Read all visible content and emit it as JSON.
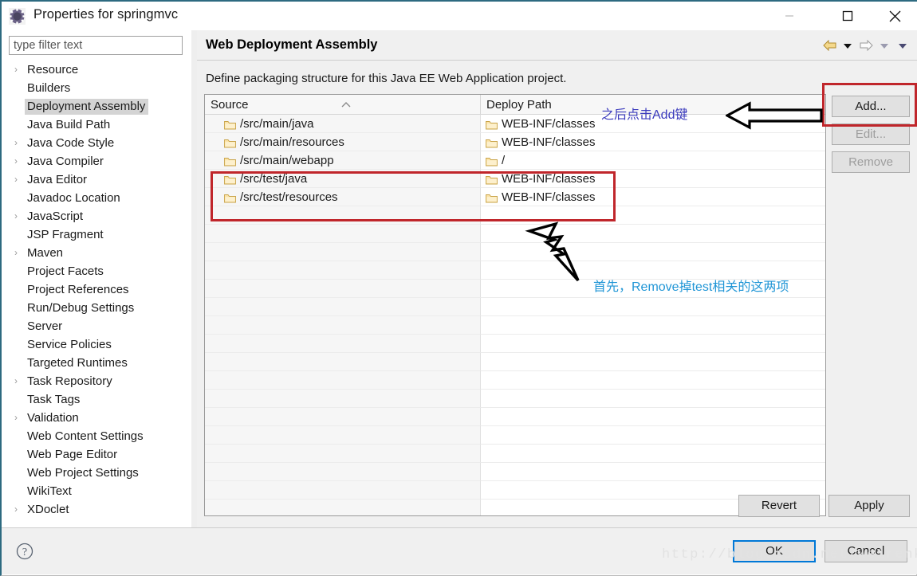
{
  "window": {
    "title": "Properties for springmvc",
    "app_icon": "gear-icon",
    "minimize_label": "Minimize",
    "maximize_label": "Maximize",
    "close_label": "Close"
  },
  "sidebar": {
    "filter": {
      "placeholder": "type filter text",
      "value": ""
    },
    "items": [
      {
        "label": "Resource",
        "expandable": true,
        "selected": false
      },
      {
        "label": "Builders",
        "expandable": false,
        "selected": false
      },
      {
        "label": "Deployment Assembly",
        "expandable": false,
        "selected": true
      },
      {
        "label": "Java Build Path",
        "expandable": false,
        "selected": false
      },
      {
        "label": "Java Code Style",
        "expandable": true,
        "selected": false
      },
      {
        "label": "Java Compiler",
        "expandable": true,
        "selected": false
      },
      {
        "label": "Java Editor",
        "expandable": true,
        "selected": false
      },
      {
        "label": "Javadoc Location",
        "expandable": false,
        "selected": false
      },
      {
        "label": "JavaScript",
        "expandable": true,
        "selected": false
      },
      {
        "label": "JSP Fragment",
        "expandable": false,
        "selected": false
      },
      {
        "label": "Maven",
        "expandable": true,
        "selected": false
      },
      {
        "label": "Project Facets",
        "expandable": false,
        "selected": false
      },
      {
        "label": "Project References",
        "expandable": false,
        "selected": false
      },
      {
        "label": "Run/Debug Settings",
        "expandable": false,
        "selected": false
      },
      {
        "label": "Server",
        "expandable": false,
        "selected": false
      },
      {
        "label": "Service Policies",
        "expandable": false,
        "selected": false
      },
      {
        "label": "Targeted Runtimes",
        "expandable": false,
        "selected": false
      },
      {
        "label": "Task Repository",
        "expandable": true,
        "selected": false
      },
      {
        "label": "Task Tags",
        "expandable": false,
        "selected": false
      },
      {
        "label": "Validation",
        "expandable": true,
        "selected": false
      },
      {
        "label": "Web Content Settings",
        "expandable": false,
        "selected": false
      },
      {
        "label": "Web Page Editor",
        "expandable": false,
        "selected": false
      },
      {
        "label": "Web Project Settings",
        "expandable": false,
        "selected": false
      },
      {
        "label": "WikiText",
        "expandable": false,
        "selected": false
      },
      {
        "label": "XDoclet",
        "expandable": true,
        "selected": false
      }
    ]
  },
  "page": {
    "title": "Web Deployment Assembly",
    "description": "Define packaging structure for this Java EE Web Application project.",
    "nav": {
      "back_icon": "back-arrow-icon",
      "back_menu_icon": "chevron-down-icon",
      "forward_icon": "forward-arrow-icon",
      "forward_menu_icon": "chevron-down-icon",
      "view_menu_icon": "chevron-down-icon"
    }
  },
  "table": {
    "columns": [
      {
        "key": "source",
        "label": "Source",
        "sort_indicator": "sort-asc-icon"
      },
      {
        "key": "deploy",
        "label": "Deploy Path",
        "sort_indicator": ""
      }
    ],
    "rows": [
      {
        "source": "/src/main/java",
        "deploy": "WEB-INF/classes",
        "highlighted": false
      },
      {
        "source": "/src/main/resources",
        "deploy": "WEB-INF/classes",
        "highlighted": false
      },
      {
        "source": "/src/main/webapp",
        "deploy": "/",
        "highlighted": false
      },
      {
        "source": "/src/test/java",
        "deploy": "WEB-INF/classes",
        "highlighted": true
      },
      {
        "source": "/src/test/resources",
        "deploy": "WEB-INF/classes",
        "highlighted": true
      }
    ],
    "empty_row_count": 17,
    "folder_icon": "folder-icon"
  },
  "buttons": {
    "add": {
      "label": "Add...",
      "enabled": true
    },
    "edit": {
      "label": "Edit...",
      "enabled": false
    },
    "remove": {
      "label": "Remove",
      "enabled": false
    },
    "revert": {
      "label": "Revert",
      "enabled": true
    },
    "apply": {
      "label": "Apply",
      "enabled": true
    },
    "ok": {
      "label": "OK",
      "enabled": true,
      "default": true
    },
    "cancel": {
      "label": "Cancel",
      "enabled": true
    }
  },
  "footer": {
    "help_icon": "help-question-icon"
  },
  "annotations": {
    "add_note": "之后点击Add键",
    "remove_note": "首先，Remove掉test相关的这两项",
    "arrow_icon": "left-block-arrow-icon",
    "bolt_icon": "lightning-bolt-icon",
    "highlight_color": "#c0262b",
    "add_note_color": "#3b3bbd",
    "remove_note_color": "#2196d6",
    "watermark": "http://blog.csdn.net/weirenkuan"
  }
}
